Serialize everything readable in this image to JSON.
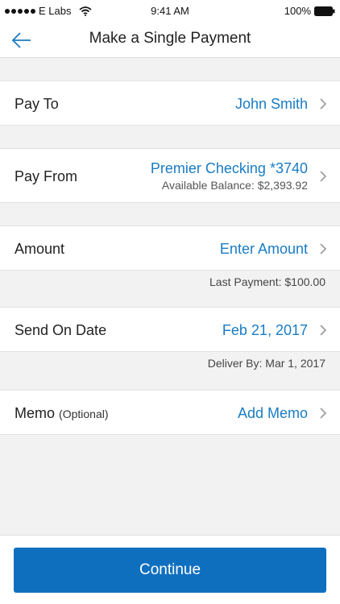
{
  "status_bar": {
    "carrier": "E Labs",
    "time": "9:41 AM",
    "battery": "100%"
  },
  "nav": {
    "title": "Make a Single Payment",
    "back_icon": "arrow-left-icon"
  },
  "rows": {
    "pay_to": {
      "label": "Pay To",
      "value": "John Smith"
    },
    "pay_from": {
      "label": "Pay From",
      "value": "Premier Checking *3740",
      "sub": "Available Balance: $2,393.92"
    },
    "amount": {
      "label": "Amount",
      "value": "Enter Amount",
      "note": "Last Payment: $100.00"
    },
    "send_on": {
      "label": "Send On Date",
      "value": "Feb 21, 2017",
      "note": "Deliver By: Mar 1, 2017"
    },
    "memo": {
      "label": "Memo",
      "optional": "(Optional)",
      "value": "Add Memo"
    }
  },
  "continue_label": "Continue",
  "colors": {
    "accent": "#1a7cc4",
    "button": "#0f6fbf",
    "background": "#f2f2f2"
  }
}
